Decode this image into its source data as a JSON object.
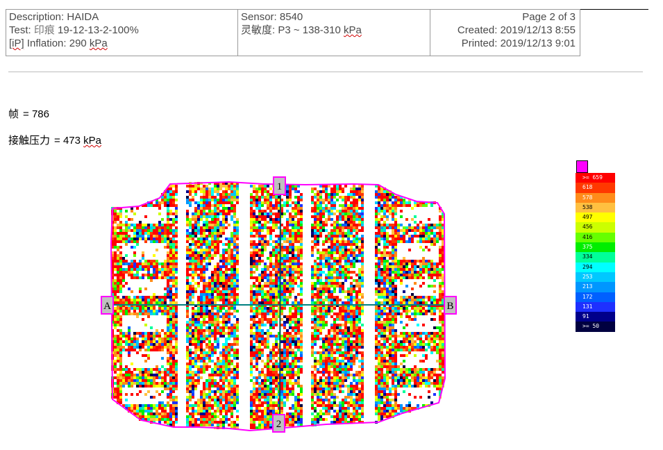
{
  "header": {
    "description": "Description: HAIDA",
    "test_label": "Test: ",
    "test_cn": "印痕",
    "test_value": " 19-12-13-2-100%",
    "inflation_prefix": "[iP]",
    "inflation_text": " Inflation: 290 ",
    "inflation_unit": "kPa",
    "sensor": "Sensor: 8540",
    "sensitivity_prefix": "灵敏度: P3 ~ 138-310 ",
    "sensitivity_unit": "kPa",
    "page": "Page 2 of 3",
    "created": "Created: 2019/12/13 8:55",
    "printed": "Printed: 2019/12/13 9:01"
  },
  "frame": {
    "label": "帧",
    "value": "= 786"
  },
  "contact_pressure": {
    "label": "接触压力",
    "value_prefix": "= 473 ",
    "unit": "kPa"
  },
  "markers": {
    "a": "A",
    "b": "B",
    "one": "1",
    "two": "2"
  },
  "legend": {
    "items": [
      {
        "label": ">= 659",
        "color": "#ff0000",
        "text": "#ffffff"
      },
      {
        "label": "618",
        "color": "#ff3800",
        "text": "#ffffff"
      },
      {
        "label": "578",
        "color": "#ff8c1a",
        "text": "#ffffff"
      },
      {
        "label": "538",
        "color": "#ffc040",
        "text": "#000000"
      },
      {
        "label": "497",
        "color": "#ffff00",
        "text": "#000000"
      },
      {
        "label": "456",
        "color": "#ccff00",
        "text": "#000000"
      },
      {
        "label": "416",
        "color": "#66ff00",
        "text": "#000000"
      },
      {
        "label": "375",
        "color": "#00ee00",
        "text": "#ffffff"
      },
      {
        "label": "334",
        "color": "#00ff99",
        "text": "#000000"
      },
      {
        "label": "294",
        "color": "#00ffff",
        "text": "#000000"
      },
      {
        "label": "253",
        "color": "#00c8ff",
        "text": "#ffffff"
      },
      {
        "label": "213",
        "color": "#0096ff",
        "text": "#ffffff"
      },
      {
        "label": "172",
        "color": "#0060ff",
        "text": "#ffffff"
      },
      {
        "label": "131",
        "color": "#1e30ff",
        "text": "#ffffff"
      },
      {
        "label": "91",
        "color": "#00008a",
        "text": "#ffffff"
      },
      {
        "label": ">= 50",
        "color": "#000040",
        "text": "#ffffff"
      }
    ]
  },
  "colors": {
    "outline": "#ff00ff",
    "axis": "#008080",
    "marker_fill": "#c0c0c0"
  }
}
